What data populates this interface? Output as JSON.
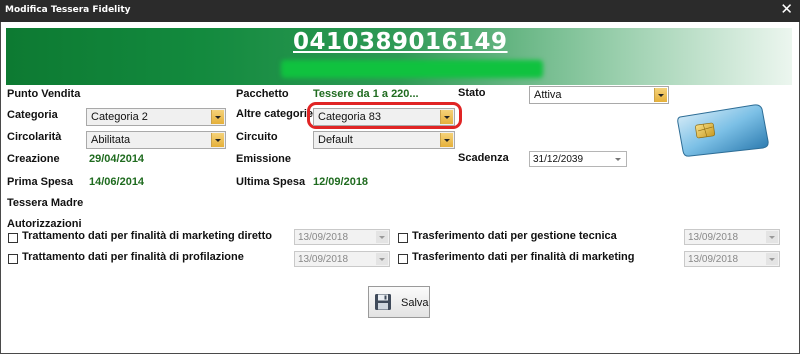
{
  "window": {
    "title": "Modifica Tessera Fidelity",
    "close_label": "✕"
  },
  "banner": {
    "card_number": "0410389016149"
  },
  "fields": {
    "punto_vendita": {
      "label": "Punto Vendita"
    },
    "pacchetto": {
      "label": "Pacchetto",
      "value": "Tessere da 1 a 220..."
    },
    "stato": {
      "label": "Stato",
      "value": "Attiva"
    },
    "categoria": {
      "label": "Categoria",
      "value": "Categoria 2"
    },
    "altre_categorie": {
      "label": "Altre categorie",
      "value": "Categoria 83"
    },
    "circolarita": {
      "label": "Circolarità",
      "value": "Abilitata"
    },
    "circuito": {
      "label": "Circuito",
      "value": "Default"
    },
    "creazione": {
      "label": "Creazione",
      "value": "29/04/2014"
    },
    "emissione": {
      "label": "Emissione"
    },
    "scadenza": {
      "label": "Scadenza",
      "value": "31/12/2039"
    },
    "prima_spesa": {
      "label": "Prima Spesa",
      "value": "14/06/2014"
    },
    "ultima_spesa": {
      "label": "Ultima Spesa",
      "value": "12/09/2018"
    },
    "tessera_madre": {
      "label": "Tessera Madre"
    }
  },
  "autorizzazioni": {
    "title": "Autorizzazioni",
    "items": [
      {
        "label": "Trattamento dati per finalità di marketing diretto",
        "date": "13/09/2018"
      },
      {
        "label": "Trasferimento dati per gestione tecnica",
        "date": "13/09/2018"
      },
      {
        "label": "Trattamento dati per finalità di profilazione",
        "date": "13/09/2018"
      },
      {
        "label": "Trasferimento dati per finalità di marketing",
        "date": "13/09/2018"
      }
    ]
  },
  "actions": {
    "save_label": "Salva"
  },
  "colors": {
    "banner_green": "#0d7a32",
    "value_green": "#1f6b1f",
    "highlight_red": "#e02424",
    "combo_arrow": "#e5b03a"
  }
}
